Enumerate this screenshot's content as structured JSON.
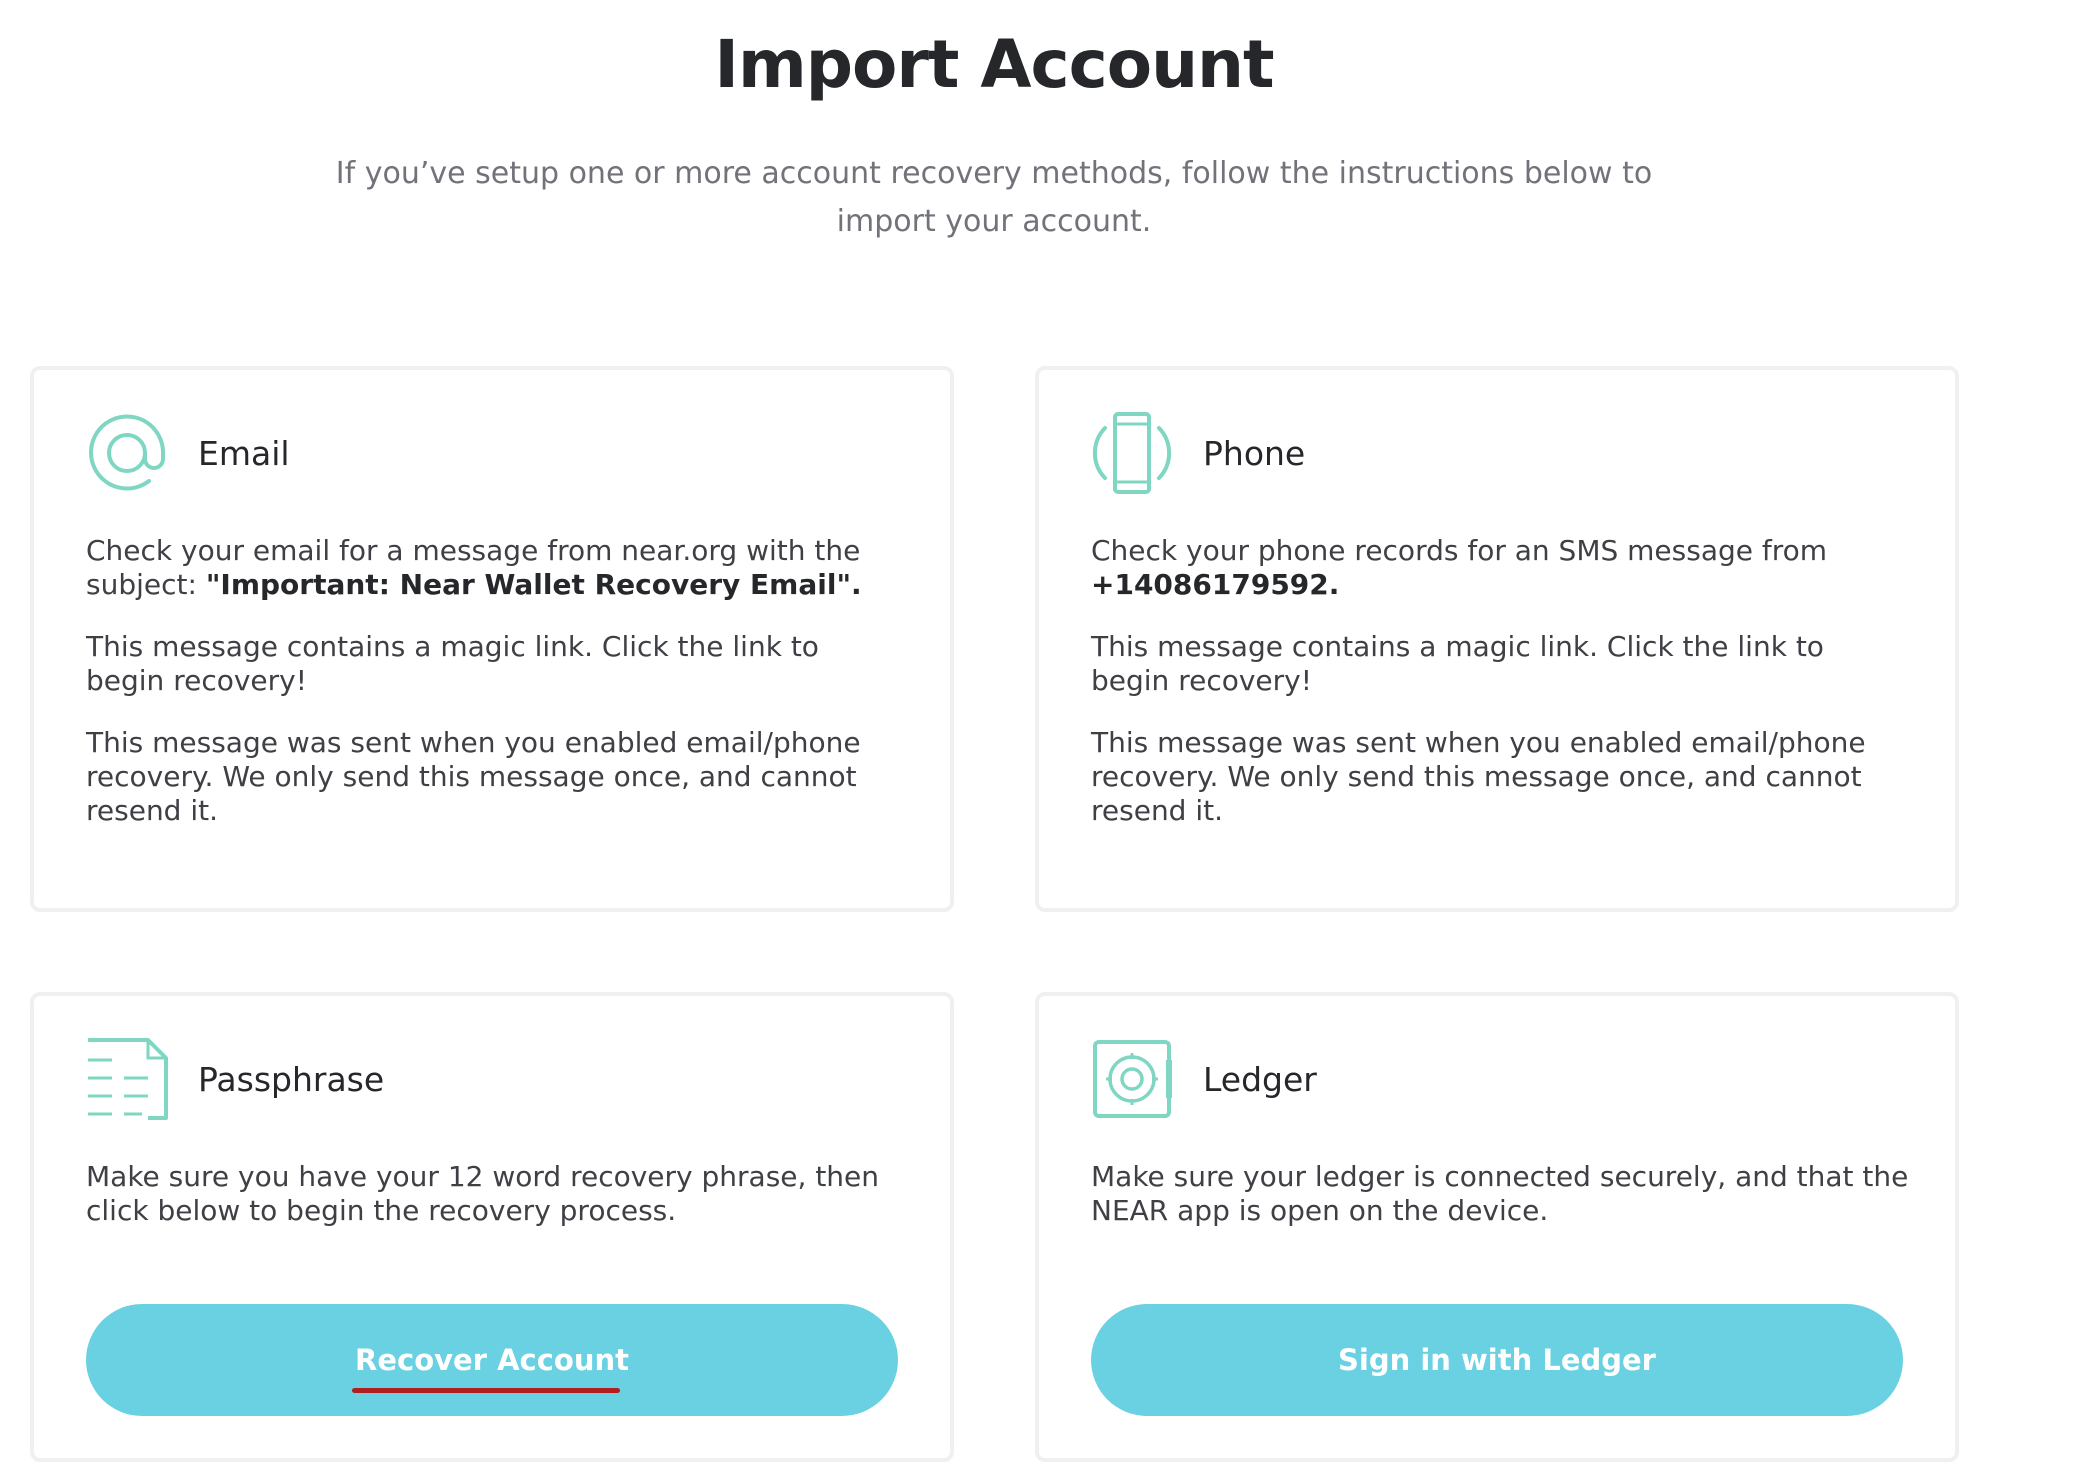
{
  "header": {
    "title": "Import Account",
    "subtitle": "If you’ve setup one or more account recovery methods, follow the instructions below to import your account."
  },
  "colors": {
    "accent": "#6ad1e3",
    "icon": "#7fd6c2",
    "underline": "#b01e1e"
  },
  "cards": {
    "email": {
      "icon": "at-sign-icon",
      "title": "Email",
      "p1_prefix": "Check your email for a message from near.org with the subject: ",
      "p1_strong": "\"Important: Near Wallet Recovery Email\".",
      "p2": "This message contains a magic link. Click the link to begin recovery!",
      "p3": "This message was sent when you enabled email/phone recovery. We only send this message once, and cannot resend it."
    },
    "phone": {
      "icon": "phone-icon",
      "title": "Phone",
      "p1_prefix": "Check your phone records for an SMS message from ",
      "p1_strong": "+14086179592.",
      "p2": "This message contains a magic link. Click the link to begin recovery!",
      "p3": "This message was sent when you enabled email/phone recovery. We only send this message once, and cannot resend it."
    },
    "passphrase": {
      "icon": "document-lines-icon",
      "title": "Passphrase",
      "body": "Make sure you have your 12 word recovery phrase, then click below to begin the recovery process.",
      "button": "Recover Account"
    },
    "ledger": {
      "icon": "ledger-device-icon",
      "title": "Ledger",
      "body": "Make sure your ledger is connected securely, and that the NEAR app is open on the device.",
      "button": "Sign in with Ledger"
    }
  }
}
